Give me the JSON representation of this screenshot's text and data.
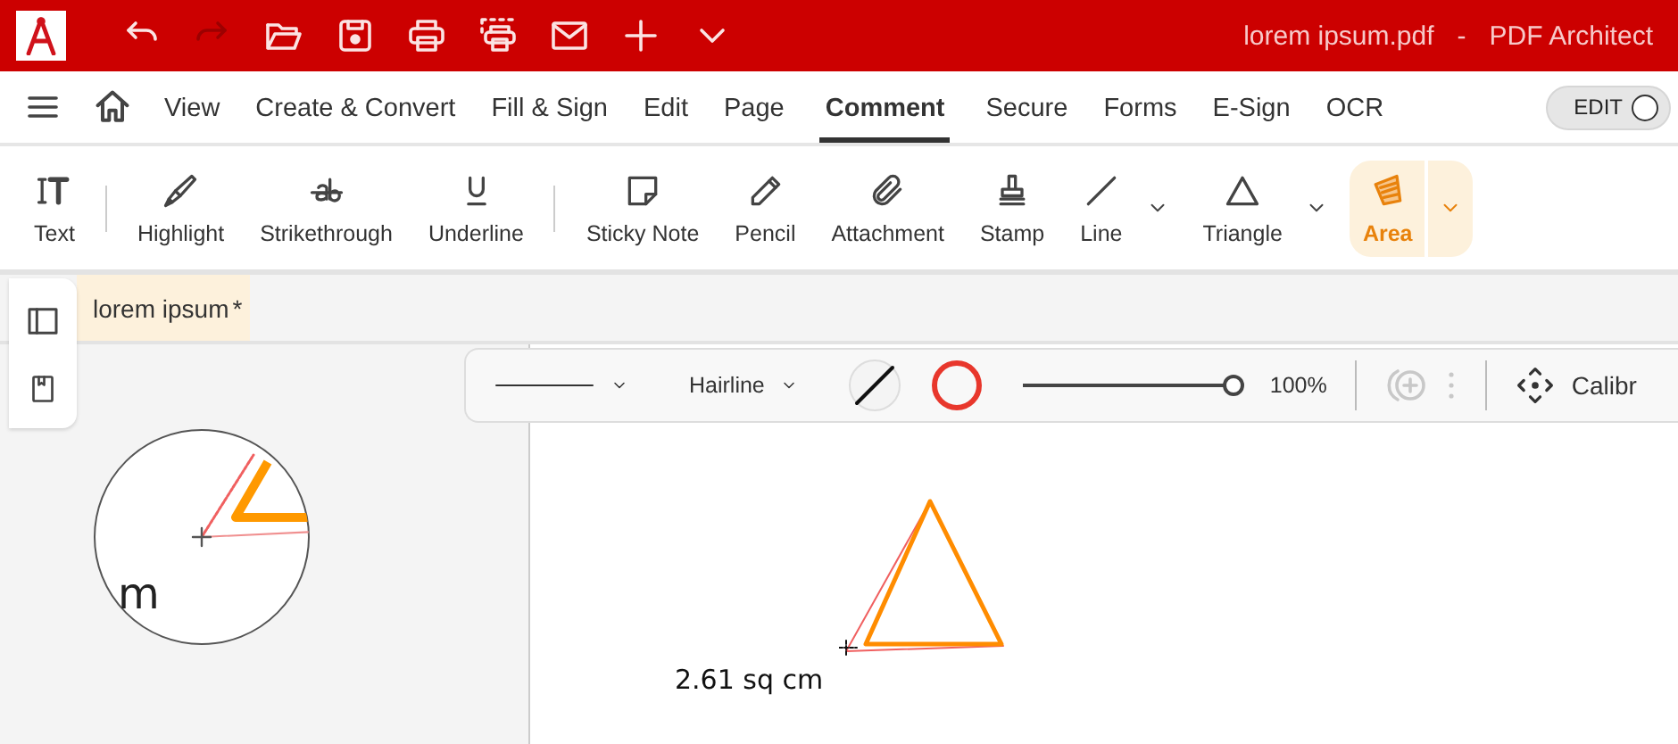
{
  "title_bar": {
    "quick_actions": [
      {
        "kind": "undo",
        "disabled": false
      },
      {
        "kind": "redo",
        "disabled": true
      },
      {
        "kind": "open",
        "disabled": false
      },
      {
        "kind": "save",
        "disabled": false
      },
      {
        "kind": "print",
        "disabled": false
      },
      {
        "kind": "print-area",
        "disabled": false
      },
      {
        "kind": "mail",
        "disabled": false
      },
      {
        "kind": "add",
        "disabled": false
      },
      {
        "kind": "more",
        "disabled": false
      }
    ],
    "document": "lorem ipsum.pdf",
    "separator": "-",
    "app_name": "PDF Architect"
  },
  "menu": {
    "tabs": [
      {
        "label": "View",
        "selected": false
      },
      {
        "label": "Create & Convert",
        "selected": false
      },
      {
        "label": "Fill & Sign",
        "selected": false
      },
      {
        "label": "Edit",
        "selected": false
      },
      {
        "label": "Page",
        "selected": false
      },
      {
        "label": "Comment",
        "selected": true
      },
      {
        "label": "Secure",
        "selected": false
      },
      {
        "label": "Forms",
        "selected": false
      },
      {
        "label": "E-Sign",
        "selected": false
      },
      {
        "label": "OCR",
        "selected": false
      }
    ],
    "mode_toggle": {
      "label": "EDIT",
      "on": false
    }
  },
  "ribbon": {
    "groups": [
      [
        {
          "label": "Text",
          "kind": "text",
          "selected": false,
          "dropdown": false
        }
      ],
      [
        {
          "label": "Highlight",
          "kind": "highlight",
          "selected": false,
          "dropdown": false
        },
        {
          "label": "Strikethrough",
          "kind": "strikethrough",
          "selected": false,
          "dropdown": false
        },
        {
          "label": "Underline",
          "kind": "underline",
          "selected": false,
          "dropdown": false
        }
      ],
      [
        {
          "label": "Sticky Note",
          "kind": "note",
          "selected": false,
          "dropdown": false
        },
        {
          "label": "Pencil",
          "kind": "pencil",
          "selected": false,
          "dropdown": false
        },
        {
          "label": "Attachment",
          "kind": "attachment",
          "selected": false,
          "dropdown": false
        },
        {
          "label": "Stamp",
          "kind": "stamp",
          "selected": false,
          "dropdown": false
        },
        {
          "label": "Line",
          "kind": "line",
          "selected": false,
          "dropdown": true
        },
        {
          "label": "Triangle",
          "kind": "triangle",
          "selected": false,
          "dropdown": true
        },
        {
          "label": "Area",
          "kind": "area",
          "selected": true,
          "dropdown": true
        }
      ]
    ]
  },
  "doc_tabs": [
    {
      "label": "lorem ipsum",
      "modified_mark": "*",
      "selected": true
    }
  ],
  "properties_bar": {
    "line_width": "Hairline",
    "fill": {
      "kind": "none"
    },
    "stroke": {
      "color": "#e8372c"
    },
    "opacity": {
      "level": 1.0,
      "reading": "100%"
    },
    "add_disabled": true,
    "calibrate": "Calibr"
  },
  "canvas": {
    "magnifier_text": "m",
    "measurement": "2.61 sq cm"
  }
}
